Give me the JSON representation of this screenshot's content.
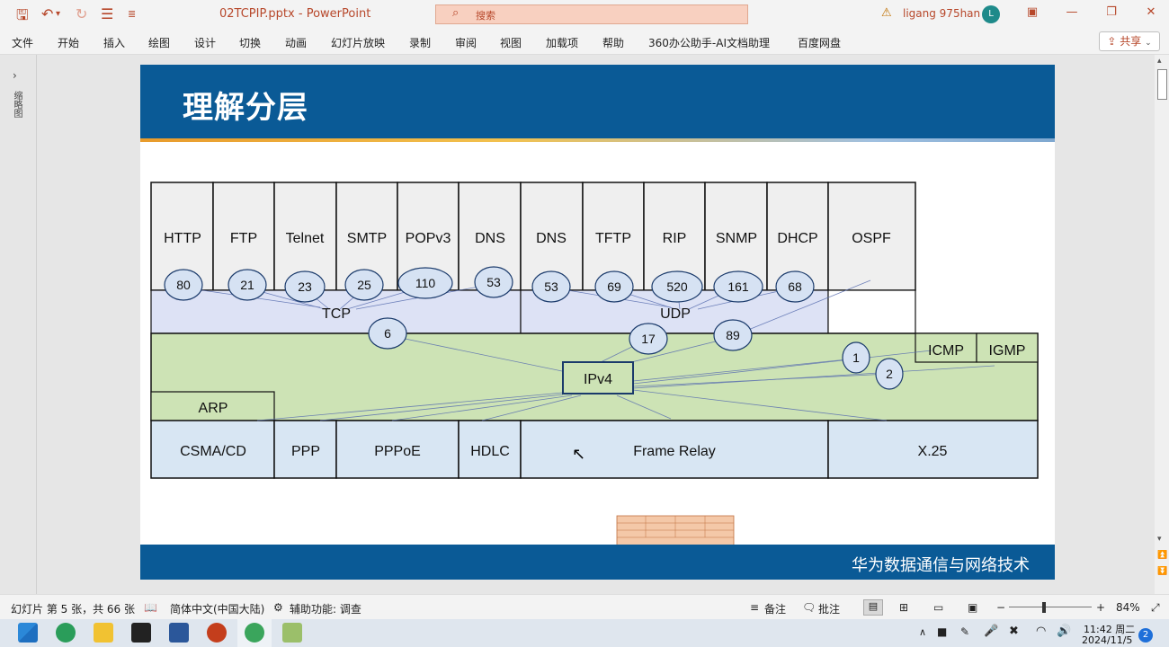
{
  "window": {
    "file_name": "02TCPIP.pptx",
    "separator": "-",
    "app_name": "PowerPoint",
    "search_placeholder": "搜索",
    "user": "ligang 975han",
    "avatar_initial": "L"
  },
  "ribbon": {
    "tabs": [
      "文件",
      "开始",
      "插入",
      "绘图",
      "设计",
      "切换",
      "动画",
      "幻灯片放映",
      "录制",
      "审阅",
      "视图",
      "加载项",
      "帮助",
      "360办公助手-AI文档助理",
      "百度网盘"
    ],
    "share_label": "共享"
  },
  "left_pane": {
    "label": "缩略图"
  },
  "slide": {
    "title": "理解分层",
    "footer": "华为数据通信与网络技术",
    "app_protocols": [
      "HTTP",
      "FTP",
      "Telnet",
      "SMTP",
      "POPv3",
      "DNS",
      "DNS",
      "TFTP",
      "RIP",
      "SNMP",
      "DHCP",
      "OSPF"
    ],
    "app_ports": [
      "80",
      "21",
      "23",
      "25",
      "110",
      "53",
      "53",
      "69",
      "520",
      "161",
      "68"
    ],
    "transport": {
      "tcp": "TCP",
      "udp": "UDP",
      "tcp_proto": "6",
      "udp_proto": "17",
      "ospf_proto": "89"
    },
    "network": {
      "ipv4": "IPv4",
      "icmp": "ICMP",
      "igmp": "IGMP",
      "icmp_proto": "1",
      "igmp_proto": "2",
      "arp": "ARP"
    },
    "link_layer": [
      "CSMA/CD",
      "PPP",
      "PPPoE",
      "HDLC",
      "Frame Relay",
      "X.25"
    ]
  },
  "status_bar": {
    "slide_info": "幻灯片 第 5 张，共 66 张",
    "language": "简体中文(中国大陆)",
    "accessibility": "辅助功能: 调查",
    "notes": "备注",
    "comments": "批注",
    "zoom": "84%",
    "zoom_minus": "−",
    "zoom_plus": "+"
  },
  "taskbar": {
    "time": "11:42 周二",
    "date": "2024/11/5",
    "notifications": "2"
  },
  "colors": {
    "app_accent": "#b7472a",
    "header_blue": "#0a5a96",
    "app_cell": "#efefef",
    "transport_fill": "#dde2f5",
    "network_fill": "#cde3b5",
    "link_fill": "#d8e6f3",
    "port_fill": "#d6e2f3"
  }
}
